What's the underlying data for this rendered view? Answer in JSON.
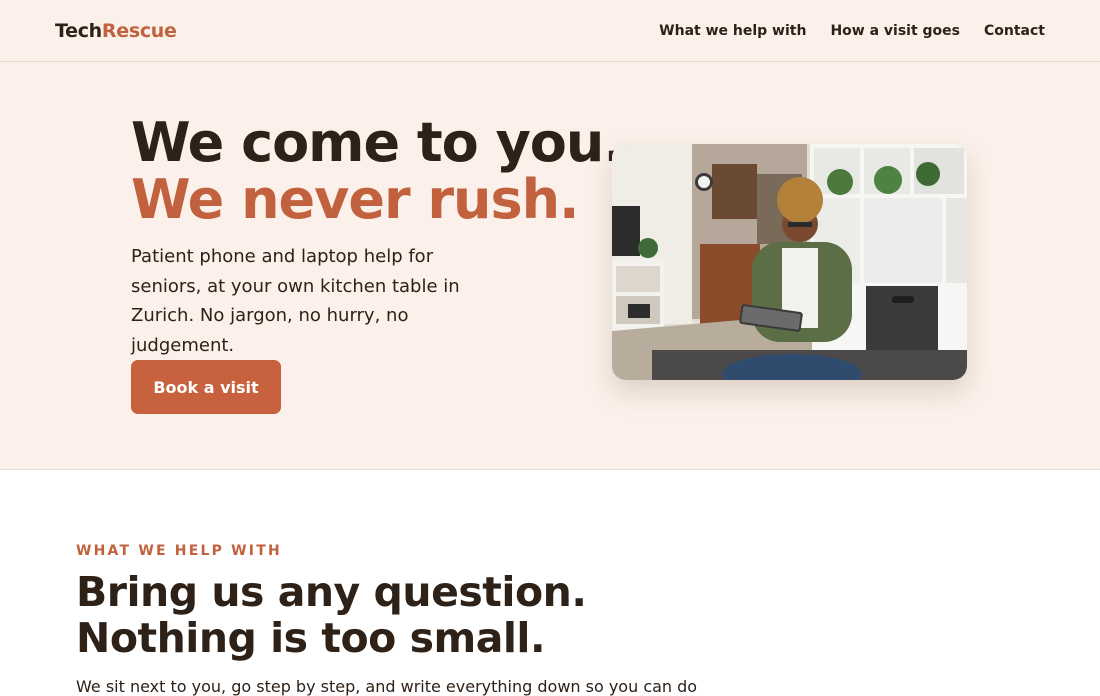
{
  "header": {
    "logo_part1": "Tech",
    "logo_part2": "Rescue",
    "nav": [
      "What we help with",
      "How a visit goes",
      "Contact"
    ]
  },
  "hero": {
    "headline_line1": "We come to you.",
    "headline_line2": "We never rush.",
    "description": "Patient phone and laptop help for seniors, at your own kitchen table in Zurich. No jargon, no hurry, no judgement.",
    "cta_label": "Book a visit",
    "photo": "photo-woman-tablet"
  },
  "section": {
    "eyebrow": "WHAT WE HELP WITH",
    "heading_line1": "Bring us any question.",
    "heading_line2": "Nothing is too small.",
    "body": "We sit next to you, go step by step, and write everything down so you can do"
  },
  "colors": {
    "accent": "#c2613d",
    "text": "#2e2118",
    "hero_bg": "#fbf1ea"
  }
}
